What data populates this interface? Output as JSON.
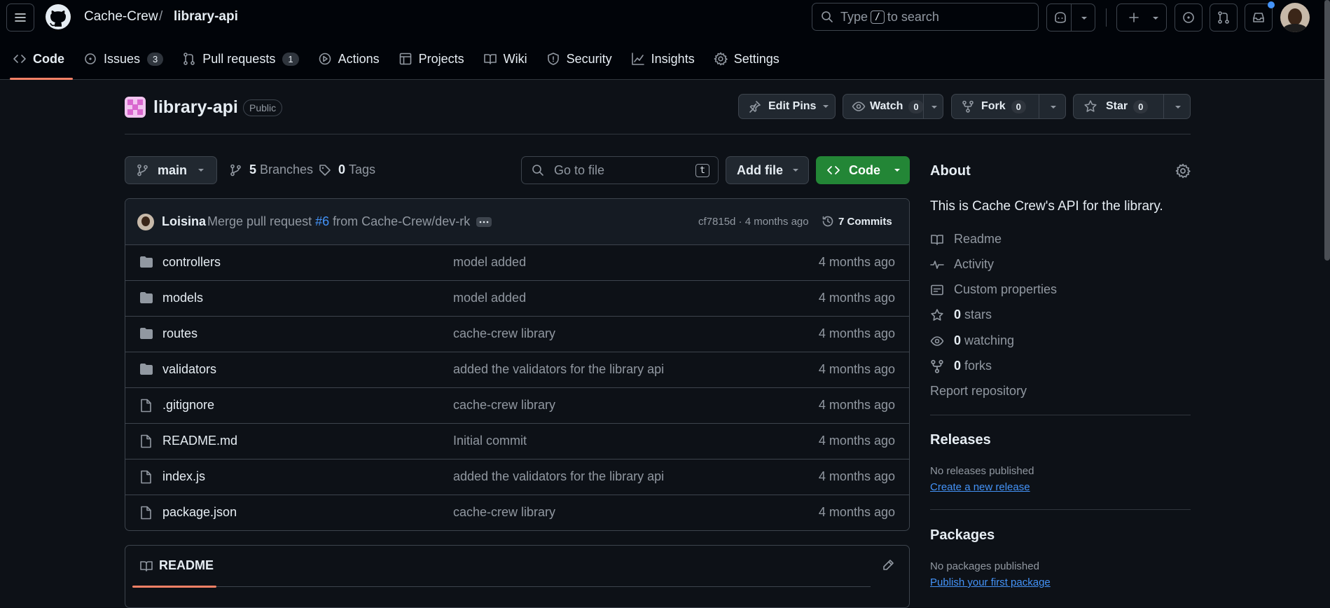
{
  "header": {
    "owner": "Cache-Crew",
    "separator": "/",
    "repo": "library-api",
    "search_prefix": "Type",
    "search_key": "/",
    "search_suffix": "to search"
  },
  "tabs": [
    {
      "label": "Code",
      "icon": "code-icon",
      "active": true
    },
    {
      "label": "Issues",
      "icon": "issue-icon",
      "count": "3"
    },
    {
      "label": "Pull requests",
      "icon": "pull-request-icon",
      "count": "1"
    },
    {
      "label": "Actions",
      "icon": "play-icon"
    },
    {
      "label": "Projects",
      "icon": "table-icon"
    },
    {
      "label": "Wiki",
      "icon": "book-icon"
    },
    {
      "label": "Security",
      "icon": "shield-icon"
    },
    {
      "label": "Insights",
      "icon": "graph-icon"
    },
    {
      "label": "Settings",
      "icon": "gear-icon"
    }
  ],
  "repo": {
    "name": "library-api",
    "visibility": "Public",
    "edit_pins": "Edit Pins",
    "watch": "Watch",
    "watch_count": "0",
    "fork": "Fork",
    "fork_count": "0",
    "star": "Star",
    "star_count": "0"
  },
  "filenav": {
    "branch": "main",
    "branches_count": "5",
    "branches_label": "Branches",
    "tags_count": "0",
    "tags_label": "Tags",
    "goto_placeholder": "Go to file",
    "goto_key": "t",
    "add_file": "Add file",
    "code": "Code"
  },
  "commit": {
    "author": "Loisina",
    "message_prefix": "Merge pull request",
    "pr": "#6",
    "message_suffix": "from Cache-Crew/dev-rk",
    "hash_time": "cf7815d · 4 months ago",
    "commits": "7 Commits"
  },
  "files": [
    {
      "name": "controllers",
      "type": "folder",
      "message": "model added",
      "time": "4 months ago"
    },
    {
      "name": "models",
      "type": "folder",
      "message": "model added",
      "time": "4 months ago"
    },
    {
      "name": "routes",
      "type": "folder",
      "message": "cache-crew library",
      "time": "4 months ago"
    },
    {
      "name": "validators",
      "type": "folder",
      "message": "added the validators for the library api",
      "time": "4 months ago"
    },
    {
      "name": ".gitignore",
      "type": "file",
      "message": "cache-crew library",
      "time": "4 months ago"
    },
    {
      "name": "README.md",
      "type": "file",
      "message": "Initial commit",
      "time": "4 months ago"
    },
    {
      "name": "index.js",
      "type": "file",
      "message": "added the validators for the library api",
      "time": "4 months ago"
    },
    {
      "name": "package.json",
      "type": "file",
      "message": "cache-crew library",
      "time": "4 months ago"
    }
  ],
  "readme": {
    "title": "README"
  },
  "about": {
    "title": "About",
    "description": "This is Cache Crew's API for the library.",
    "readme": "Readme",
    "activity": "Activity",
    "custom_properties": "Custom properties",
    "stars_count": "0",
    "stars": "stars",
    "watching_count": "0",
    "watching": "watching",
    "forks_count": "0",
    "forks": "forks",
    "report": "Report repository"
  },
  "releases": {
    "title": "Releases",
    "empty": "No releases published",
    "create": "Create a new release"
  },
  "packages": {
    "title": "Packages",
    "empty": "No packages published",
    "publish": "Publish your first package"
  },
  "colors": {
    "bg": "#0d1117",
    "header_bg": "#010409",
    "accent_tab": "#f78166",
    "code_button": "#238636",
    "link": "#4493f8"
  }
}
